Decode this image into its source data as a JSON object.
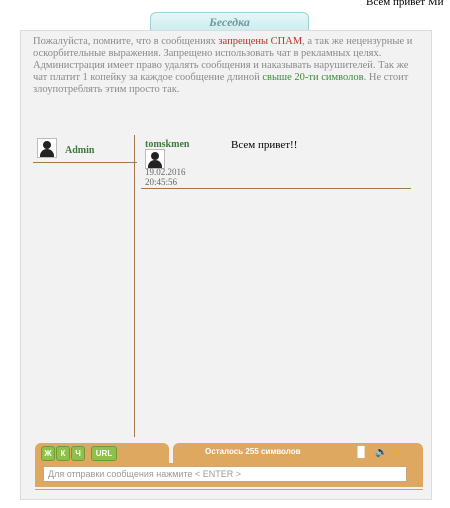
{
  "ticker_text": "Всем привет Ми",
  "title": "Беседка",
  "notice": {
    "part1": "Пожалуйста, помните, что в сообщениях ",
    "red": "запрещены СПАМ",
    "part2": ", а так же нецензурные и оскорбительные выражения. Запрещено использовать чат в рекламных целях. Администрация имеет право удалять сообщения и наказывать нарушителей. Так же чат платит 1 копейку за каждое сообщение длиной ",
    "green": "свыше 20-ти символов",
    "part3": ". Не стоит злоупотреблять этим просто так."
  },
  "users": [
    {
      "name": "Admin"
    }
  ],
  "messages": [
    {
      "author": "tomskmen",
      "date": "19.02.2016",
      "time": "20:45:56",
      "text": "Всем привет!!"
    }
  ],
  "toolbar": {
    "bold": "Ж",
    "italic": "К",
    "underline": "Ч",
    "url": "URL",
    "counter": "Осталось 255 символов"
  },
  "input": {
    "placeholder": "Для отправки сообщения нажмите < ENTER >"
  },
  "colors": {
    "accent": "#dfa860",
    "button_green": "#8fc04a",
    "name_green": "#3d7a3d",
    "warning_red": "#c03030"
  }
}
